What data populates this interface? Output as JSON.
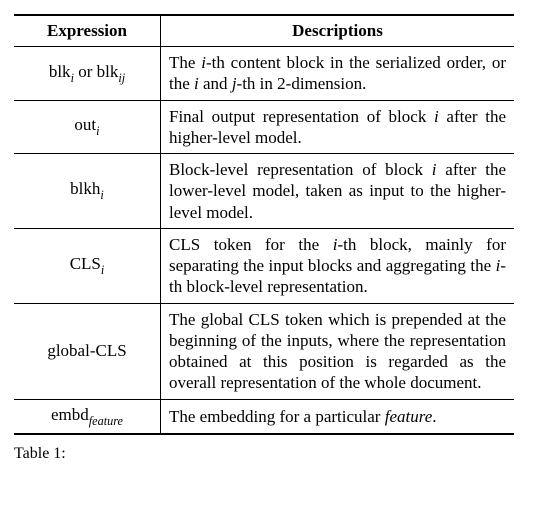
{
  "table": {
    "header": {
      "left": "Expression",
      "right": "Descriptions"
    },
    "rows": [
      {
        "expr_html": "blk<span class='sub ital'>i</span> or blk<span class='sub ital'>ij</span>",
        "desc_html": "The <span class='ital'>i</span>-th content block in the serialized order, or the <span class='ital'>i</span> and <span class='ital'>j</span>-th in 2-dimension."
      },
      {
        "expr_html": "out<span class='sub ital'>i</span>",
        "desc_html": "Final output representation of block <span class='ital'>i</span> after the higher-level model."
      },
      {
        "expr_html": "blkh<span class='sub ital'>i</span>",
        "desc_html": "Block-level representation of block <span class='ital'>i</span> after the lower-level model, taken as input to the higher-level model."
      },
      {
        "expr_html": "CLS<span class='sub ital'>i</span>",
        "desc_html": "CLS token for the <span class='ital'>i</span>-th block, mainly for separating the input blocks and aggregating the <span class='ital'>i</span>-th block-level representation."
      },
      {
        "expr_html": "global-CLS",
        "desc_html": "The global CLS token which is prepended at the beginning of the inputs, where the representation obtained at this position is regarded as the overall representation of the whole document."
      },
      {
        "expr_html": "embd<span class='sub ital'>feature</span>",
        "desc_html": "The embedding for a particular <span class='ital'>feature</span>."
      }
    ]
  },
  "caption_prefix": "Table 1:",
  "chart_data": {
    "type": "table",
    "columns": [
      "Expression",
      "Descriptions"
    ],
    "rows": [
      [
        "blk_i or blk_ij",
        "The i-th content block in the serialized order, or the i and j-th in 2-dimension."
      ],
      [
        "out_i",
        "Final output representation of block i after the higher-level model."
      ],
      [
        "blkh_i",
        "Block-level representation of block i after the lower-level model, taken as input to the higher-level model."
      ],
      [
        "CLS_i",
        "CLS token for the i-th block, mainly for separating the input blocks and aggregating the i-th block-level representation."
      ],
      [
        "global-CLS",
        "The global CLS token which is prepended at the beginning of the inputs, where the representation obtained at this position is regarded as the overall representation of the whole document."
      ],
      [
        "embd_feature",
        "The embedding for a particular feature."
      ]
    ]
  }
}
